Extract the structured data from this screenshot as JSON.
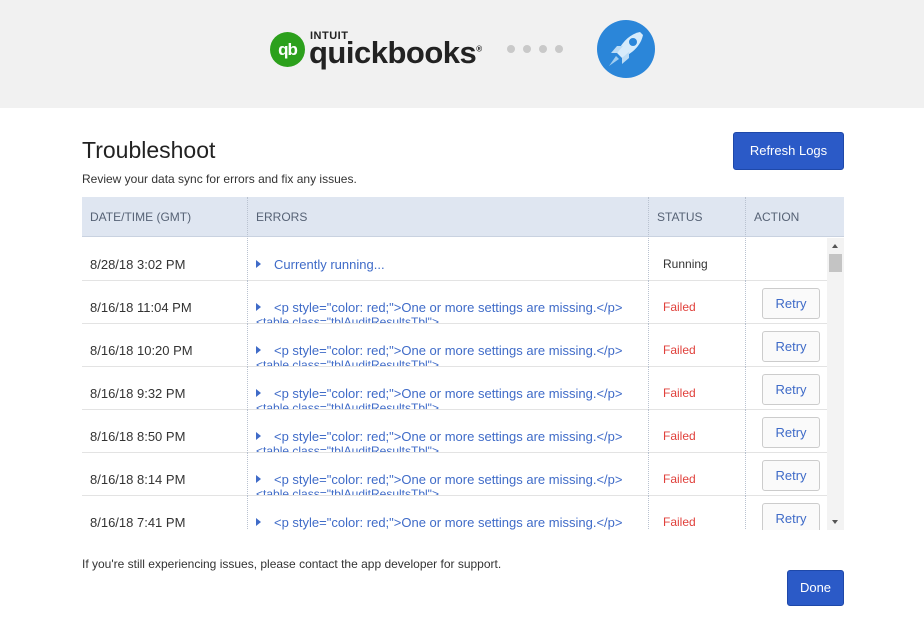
{
  "header": {
    "logo_badge": "qb",
    "logo_intuit": "INTUIT",
    "logo_word": "quickbooks",
    "logo_tm": "®"
  },
  "page": {
    "title": "Troubleshoot",
    "subtitle": "Review your data sync for errors and fix any issues.",
    "refresh_label": "Refresh Logs",
    "footer": "If you're still experiencing issues, please contact the app developer for support.",
    "done_label": "Done"
  },
  "table": {
    "columns": [
      "DATE/TIME (GMT)",
      "ERRORS",
      "STATUS",
      "ACTION"
    ],
    "rows": [
      {
        "date": "8/28/18 3:02 PM",
        "error": "Currently running...",
        "error_cut": "",
        "status": "Running",
        "action": ""
      },
      {
        "date": "8/16/18 11:04 PM",
        "error": "<p style=\"color: red;\">One or more settings are missing.</p>",
        "error_cut": "<table class=\"tblAuditResultsTbl\">",
        "status": "Failed",
        "action": "Retry"
      },
      {
        "date": "8/16/18 10:20 PM",
        "error": "<p style=\"color: red;\">One or more settings are missing.</p>",
        "error_cut": "<table class=\"tblAuditResultsTbl\">",
        "status": "Failed",
        "action": "Retry"
      },
      {
        "date": "8/16/18 9:32 PM",
        "error": "<p style=\"color: red;\">One or more settings are missing.</p>",
        "error_cut": "<table class=\"tblAuditResultsTbl\">",
        "status": "Failed",
        "action": "Retry"
      },
      {
        "date": "8/16/18 8:50 PM",
        "error": "<p style=\"color: red;\">One or more settings are missing.</p>",
        "error_cut": "<table class=\"tblAuditResultsTbl\">",
        "status": "Failed",
        "action": "Retry"
      },
      {
        "date": "8/16/18 8:14 PM",
        "error": "<p style=\"color: red;\">One or more settings are missing.</p>",
        "error_cut": "<table class=\"tblAuditResultsTbl\">",
        "status": "Failed",
        "action": "Retry"
      },
      {
        "date": "8/16/18 7:41 PM",
        "error": "<p style=\"color: red;\">One or more settings are missing.</p>",
        "error_cut": "",
        "status": "Failed",
        "action": "Retry"
      }
    ]
  },
  "colors": {
    "primary": "#2b5ac7",
    "link": "#3f6bc8",
    "failed": "#e0403b",
    "header_bg": "#dfe6f1"
  },
  "icons": [
    "quickbooks-logo-icon",
    "rocket-app-icon",
    "expand-caret-icon"
  ]
}
